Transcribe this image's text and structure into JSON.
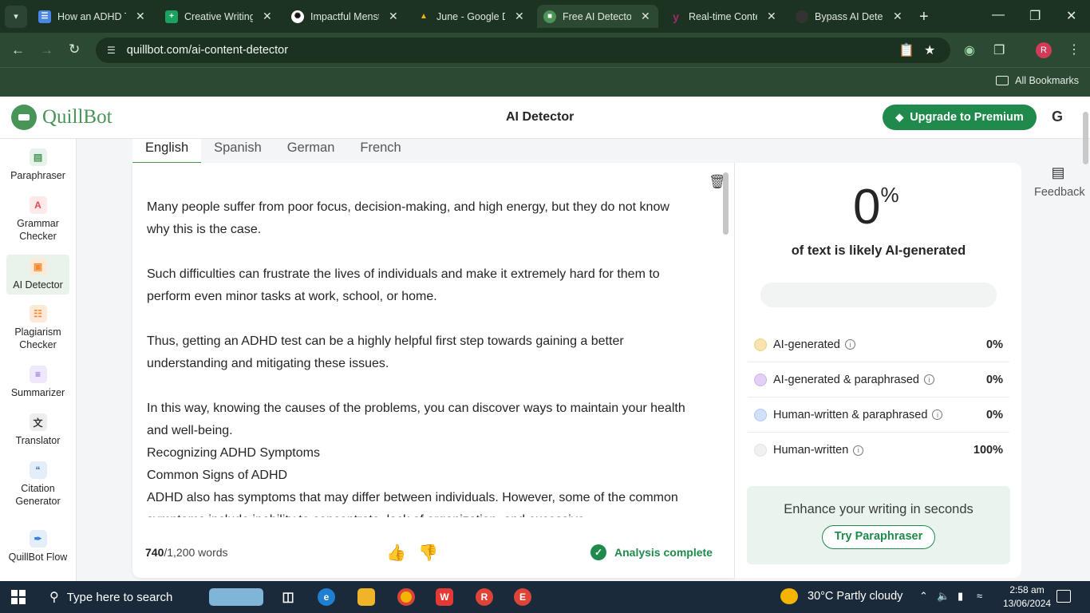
{
  "browser": {
    "tabs": [
      {
        "title": "How an ADHD Te",
        "icon": "google-docs-icon",
        "color": "#4a86e8"
      },
      {
        "title": "Creative Writing",
        "icon": "google-sheets-icon",
        "color": "#1aa260"
      },
      {
        "title": "Impactful Menst",
        "icon": "chatgpt-icon",
        "color": "#ffffff"
      },
      {
        "title": "June - Google D",
        "icon": "google-drive-icon",
        "color": "#f4b400"
      },
      {
        "title": "Free AI Detector",
        "icon": "quillbot-icon",
        "color": "#499557"
      },
      {
        "title": "Real-time Conte",
        "icon": "yoast-icon",
        "color": "#a4286a"
      },
      {
        "title": "Bypass AI Detect",
        "icon": "bypass-icon",
        "color": "#333333"
      }
    ],
    "url": "quillbot.com/ai-content-detector",
    "bookmarks_label": "All Bookmarks",
    "profile_initial": "R"
  },
  "header": {
    "logo_text": "QuillBot",
    "title": "AI Detector",
    "premium_label": "Upgrade to Premium",
    "account_initial": "G"
  },
  "sidebar": {
    "items": [
      {
        "label": "Paraphraser",
        "icon": "paraphraser-icon",
        "color": "#499557"
      },
      {
        "label": "Grammar Checker",
        "icon": "grammar-icon",
        "color": "#e5484d"
      },
      {
        "label": "AI Detector",
        "icon": "ai-detector-icon",
        "color": "#f28b30"
      },
      {
        "label": "Plagiarism Checker",
        "icon": "plagiarism-icon",
        "color": "#f28b30"
      },
      {
        "label": "Summarizer",
        "icon": "summarizer-icon",
        "color": "#7b4fd6"
      },
      {
        "label": "Translator",
        "icon": "translator-icon",
        "color": "#333333"
      },
      {
        "label": "Citation Generator",
        "icon": "citation-icon",
        "color": "#2563c9"
      },
      {
        "label": "QuillBot Flow",
        "icon": "flow-icon",
        "color": "#2f7de0"
      }
    ]
  },
  "languages": [
    "English",
    "Spanish",
    "German",
    "French"
  ],
  "editor": {
    "paragraphs": [
      "Many people suffer from poor focus, decision-making, and high energy, but they do not know why this is the case.",
      "",
      "Such difficulties can frustrate the lives of individuals and make it extremely hard for them to perform even minor tasks at work, school, or home.",
      "",
      "Thus, getting an ADHD test can be a highly helpful first step towards gaining a better understanding and mitigating these issues.",
      "",
      "In this way, knowing the causes of the problems, you can discover ways to maintain your health and well-being.",
      "Recognizing ADHD Symptoms",
      "Common Signs of ADHD",
      "ADHD also has symptoms that may differ between individuals. However, some of the common symptoms include inability to concentrate, lack of organization, and excessive"
    ],
    "word_count": "740",
    "word_limit": "/1,200 words",
    "status": "Analysis complete"
  },
  "results": {
    "percent": "0",
    "percent_sign": "%",
    "label": "of text is likely AI-generated",
    "rows": [
      {
        "label": "AI-generated",
        "value": "0%",
        "color": "#f7e4b0"
      },
      {
        "label": "AI-generated & paraphrased",
        "value": "0%",
        "color": "#e3d0f5"
      },
      {
        "label": "Human-written & paraphrased",
        "value": "0%",
        "color": "#cfe0f7"
      },
      {
        "label": "Human-written",
        "value": "100%",
        "color": "#f1f1f1"
      }
    ],
    "promo_text": "Enhance your writing in seconds",
    "promo_button": "Try Paraphraser"
  },
  "feedback_label": "Feedback",
  "taskbar": {
    "search_placeholder": "Type here to search",
    "weather": "30°C  Partly cloudy",
    "time": "2:58 am",
    "date": "13/06/2024"
  }
}
